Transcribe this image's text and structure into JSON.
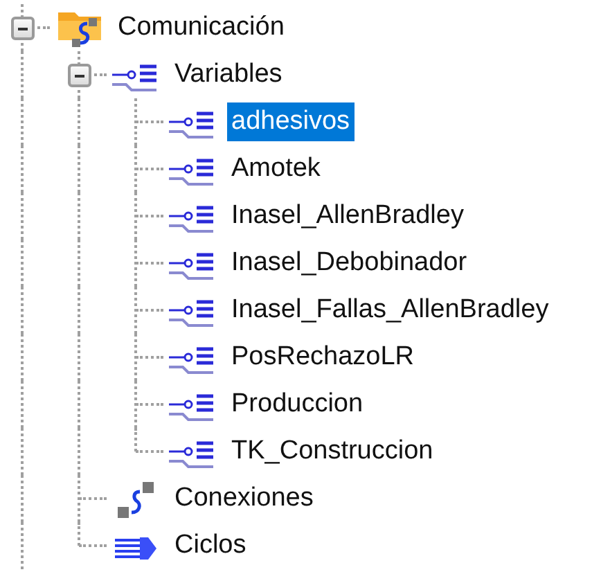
{
  "tree": [
    {
      "label": "Comunicación",
      "kind": "folder",
      "selected": false,
      "expanded": true,
      "children": [
        {
          "label": "Variables",
          "kind": "group",
          "selected": false,
          "expanded": true,
          "children": [
            {
              "label": "adhesivos",
              "kind": "variable",
              "selected": true
            },
            {
              "label": "Amotek",
              "kind": "variable",
              "selected": false
            },
            {
              "label": "Inasel_AllenBradley",
              "kind": "variable",
              "selected": false
            },
            {
              "label": "Inasel_Debobinador",
              "kind": "variable",
              "selected": false
            },
            {
              "label": "Inasel_Fallas_AllenBradley",
              "kind": "variable",
              "selected": false
            },
            {
              "label": "PosRechazoLR",
              "kind": "variable",
              "selected": false
            },
            {
              "label": "Produccion",
              "kind": "variable",
              "selected": false
            },
            {
              "label": "TK_Construccion",
              "kind": "variable",
              "selected": false
            }
          ]
        },
        {
          "label": "Conexiones",
          "kind": "connection",
          "selected": false
        },
        {
          "label": "Ciclos",
          "kind": "cycle",
          "selected": false
        }
      ]
    }
  ]
}
